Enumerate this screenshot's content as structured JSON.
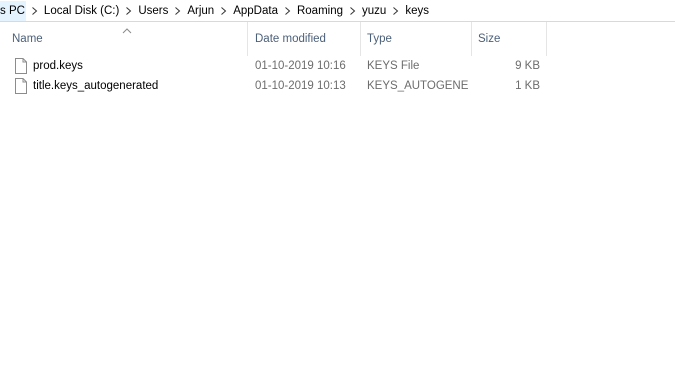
{
  "breadcrumb": [
    {
      "label": "s PC"
    },
    {
      "label": "Local Disk (C:)"
    },
    {
      "label": "Users"
    },
    {
      "label": "Arjun"
    },
    {
      "label": "AppData"
    },
    {
      "label": "Roaming"
    },
    {
      "label": "yuzu"
    },
    {
      "label": "keys"
    }
  ],
  "columns": {
    "name": "Name",
    "date_modified": "Date modified",
    "type": "Type",
    "size": "Size",
    "sort_column": "Name",
    "sort_direction": "ascending"
  },
  "files": [
    {
      "name": "prod.keys",
      "date_modified": "01-10-2019 10:16",
      "type": "KEYS File",
      "size": "9 KB",
      "icon": "file-icon"
    },
    {
      "name": "title.keys_autogenerated",
      "date_modified": "01-10-2019 10:13",
      "type": "KEYS_AUTOGENE...",
      "size": "1 KB",
      "icon": "file-icon"
    }
  ],
  "colors": {
    "header_text": "#4c607a",
    "secondary_text": "#6d6d6d",
    "hover": "#e5f3ff"
  }
}
